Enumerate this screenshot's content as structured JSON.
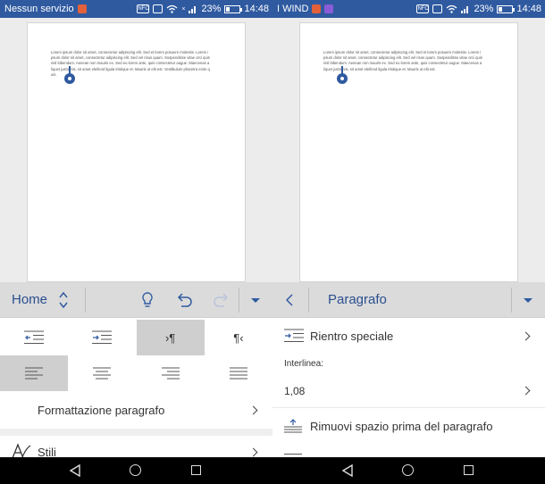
{
  "left": {
    "status": {
      "carrier": "Nessun servizio",
      "battery": "23%",
      "time": "14:48",
      "nfc": "NFC"
    },
    "document": {
      "text": "Lorem ipsum dolor sit amet, consectetur adipiscing elit. Sed et lorem posuere molestie. Lorem ipsum dolor sit amet, consectetur adipiscing elit. Sed vel risus quam. Suspendisse vitae orci quis nisl bibendum. Aenean non mauris ex. Sed eu lorem ante, quis consectetur augue. Maecenas aliquet justo nisi, sit amet eleifend ligula tristique et. Mauris ut elit est. Vestibulum pharetra enim quis."
    },
    "toolbar": {
      "title": "Home",
      "accent": "#2f5aa0"
    },
    "panel": {
      "formatting_label": "Formattazione paragrafo",
      "styles_label": "Stili",
      "ltr_label": "›¶",
      "rtl_label": "¶‹"
    }
  },
  "right": {
    "status": {
      "carrier": "I WIND",
      "battery": "23%",
      "time": "14:48",
      "nfc": "NFC"
    },
    "document": {
      "text": "Lorem ipsum dolor sit amet, consectetur adipiscing elit. Sed et lorem posuere molestie. Lorem ipsum dolor sit amet, consectetur adipiscing elit. Sed vel risus quam. Suspendisse vitae orci quis nisl bibendum. Aenean non mauris ex. Sed eu lorem ante, quis consectetur augue. Maecenas aliquet justo nisi, sit amet eleifend ligula tristique et. Mauris ut elit est."
    },
    "toolbar": {
      "title": "Paragrafo"
    },
    "panel": {
      "special_indent_label": "Rientro speciale",
      "line_spacing_label": "Interlinea:",
      "line_spacing_value": "1,08",
      "remove_space_label": "Rimuovi spazio prima del paragrafo"
    }
  }
}
